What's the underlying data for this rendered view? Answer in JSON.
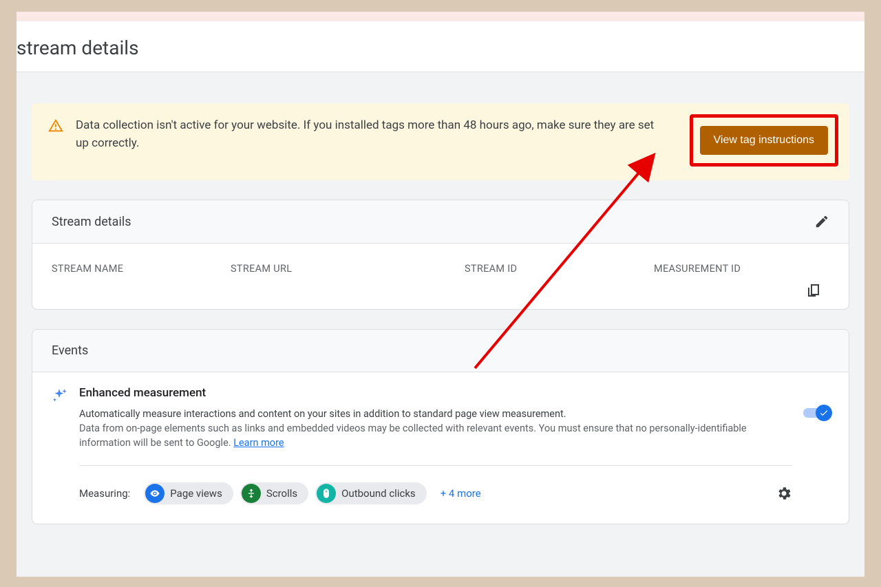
{
  "page": {
    "title": "stream details"
  },
  "alert": {
    "text": "Data collection isn't active for your website. If you installed tags more than 48 hours ago, make sure they are set up correctly.",
    "button": "View tag instructions"
  },
  "streamDetailsCard": {
    "title": "Stream details",
    "columns": {
      "name": "STREAM NAME",
      "url": "STREAM URL",
      "id": "STREAM ID",
      "measurement": "MEASUREMENT ID"
    }
  },
  "eventsCard": {
    "title": "Events",
    "enhanced": {
      "title": "Enhanced measurement",
      "desc1": "Automatically measure interactions and content on your sites in addition to standard page view measurement.",
      "desc2": "Data from on-page elements such as links and embedded videos may be collected with relevant events. You must ensure that no personally-identifiable information will be sent to Google. ",
      "learnMore": "Learn more"
    },
    "measuring": {
      "label": "Measuring:",
      "chips": [
        "Page views",
        "Scrolls",
        "Outbound clicks"
      ],
      "more": "+ 4 more"
    }
  }
}
